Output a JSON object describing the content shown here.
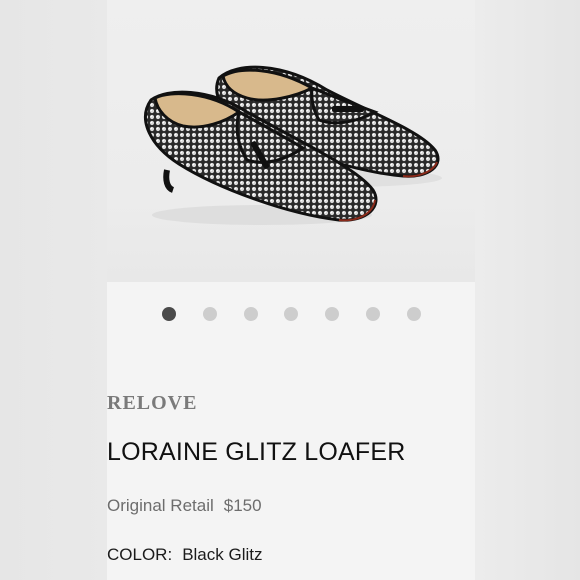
{
  "brand": {
    "logo_text": "RELOVE"
  },
  "product": {
    "title": "LORAINE GLITZ LOAFER",
    "retail_label": "Original Retail",
    "retail_price": "$150",
    "color_label": "COLOR:",
    "color_value": "Black Glitz"
  },
  "gallery": {
    "image_count": 7,
    "active_index": 0
  },
  "colors": {
    "active_dot": "#4a4a4a",
    "inactive_dot": "#cdcdcd",
    "text": "#111111",
    "muted": "#6d6d6d"
  }
}
